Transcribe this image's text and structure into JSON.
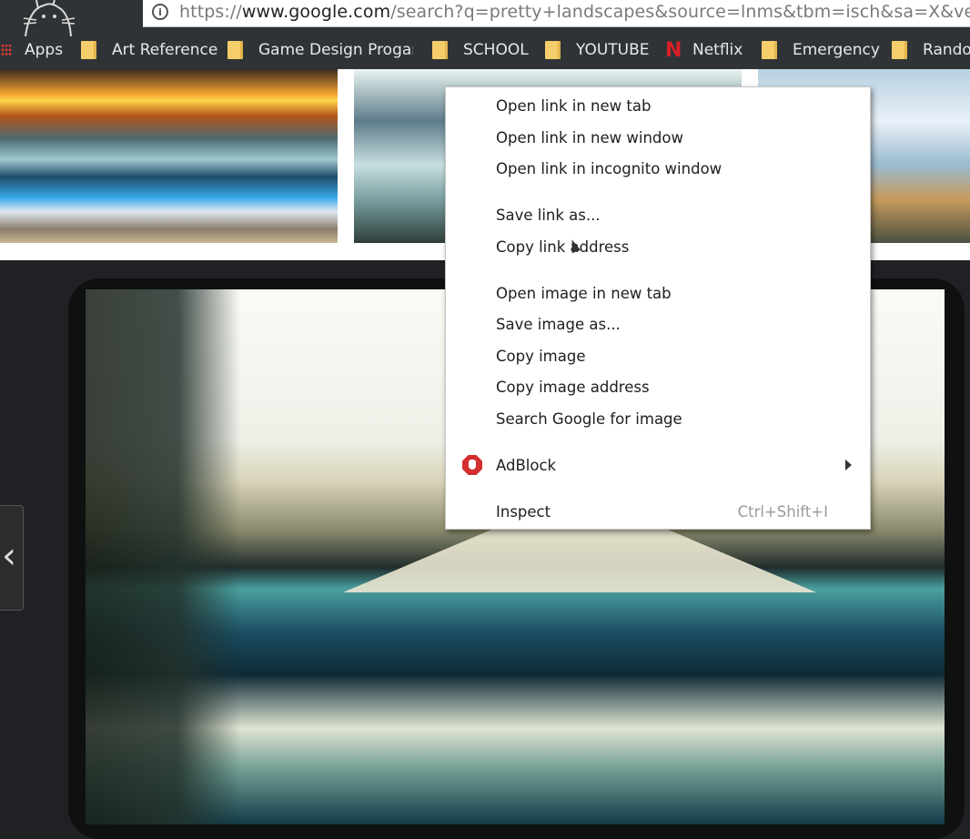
{
  "browser": {
    "url_prefix": "https://",
    "url_domain": "www.google.com",
    "url_rest": "/search?q=pretty+landscapes&source=lnms&tbm=isch&sa=X&ved=",
    "info_icon": "info-icon"
  },
  "bookmarks": [
    {
      "label": "Apps",
      "icon": "apps-grid-icon"
    },
    {
      "label": "Art Reference",
      "icon": "folder-icon"
    },
    {
      "label": "Game Design Progam",
      "icon": "folder-icon"
    },
    {
      "label": "SCHOOL",
      "icon": "folder-icon"
    },
    {
      "label": "YOUTUBE",
      "icon": "folder-icon"
    },
    {
      "label": "Netflix",
      "icon": "netflix-icon",
      "icon_text": "N"
    },
    {
      "label": "Emergency",
      "icon": "folder-icon"
    },
    {
      "label": "Rando",
      "icon": "folder-icon"
    }
  ],
  "context_menu": {
    "items": [
      {
        "label": "Open link in new tab"
      },
      {
        "label": "Open link in new window"
      },
      {
        "label": "Open link in incognito window"
      },
      {
        "label": "Save link as..."
      },
      {
        "label": "Copy link address"
      },
      {
        "label": "Open image in new tab"
      },
      {
        "label": "Save image as..."
      },
      {
        "label": "Copy image"
      },
      {
        "label": "Copy image address"
      },
      {
        "label": "Search Google for image"
      },
      {
        "label": "AdBlock",
        "icon": "adblock-icon",
        "submenu": true
      },
      {
        "label": "Inspect",
        "shortcut": "Ctrl+Shift+I"
      }
    ]
  },
  "viewer": {
    "prev_label": "‹"
  },
  "colors": {
    "chrome_bg": "#2f3336",
    "menu_bg": "#ffffff",
    "folder": "#f5cd6a",
    "adblock": "#d32f2f",
    "netflix": "#d81f26"
  }
}
